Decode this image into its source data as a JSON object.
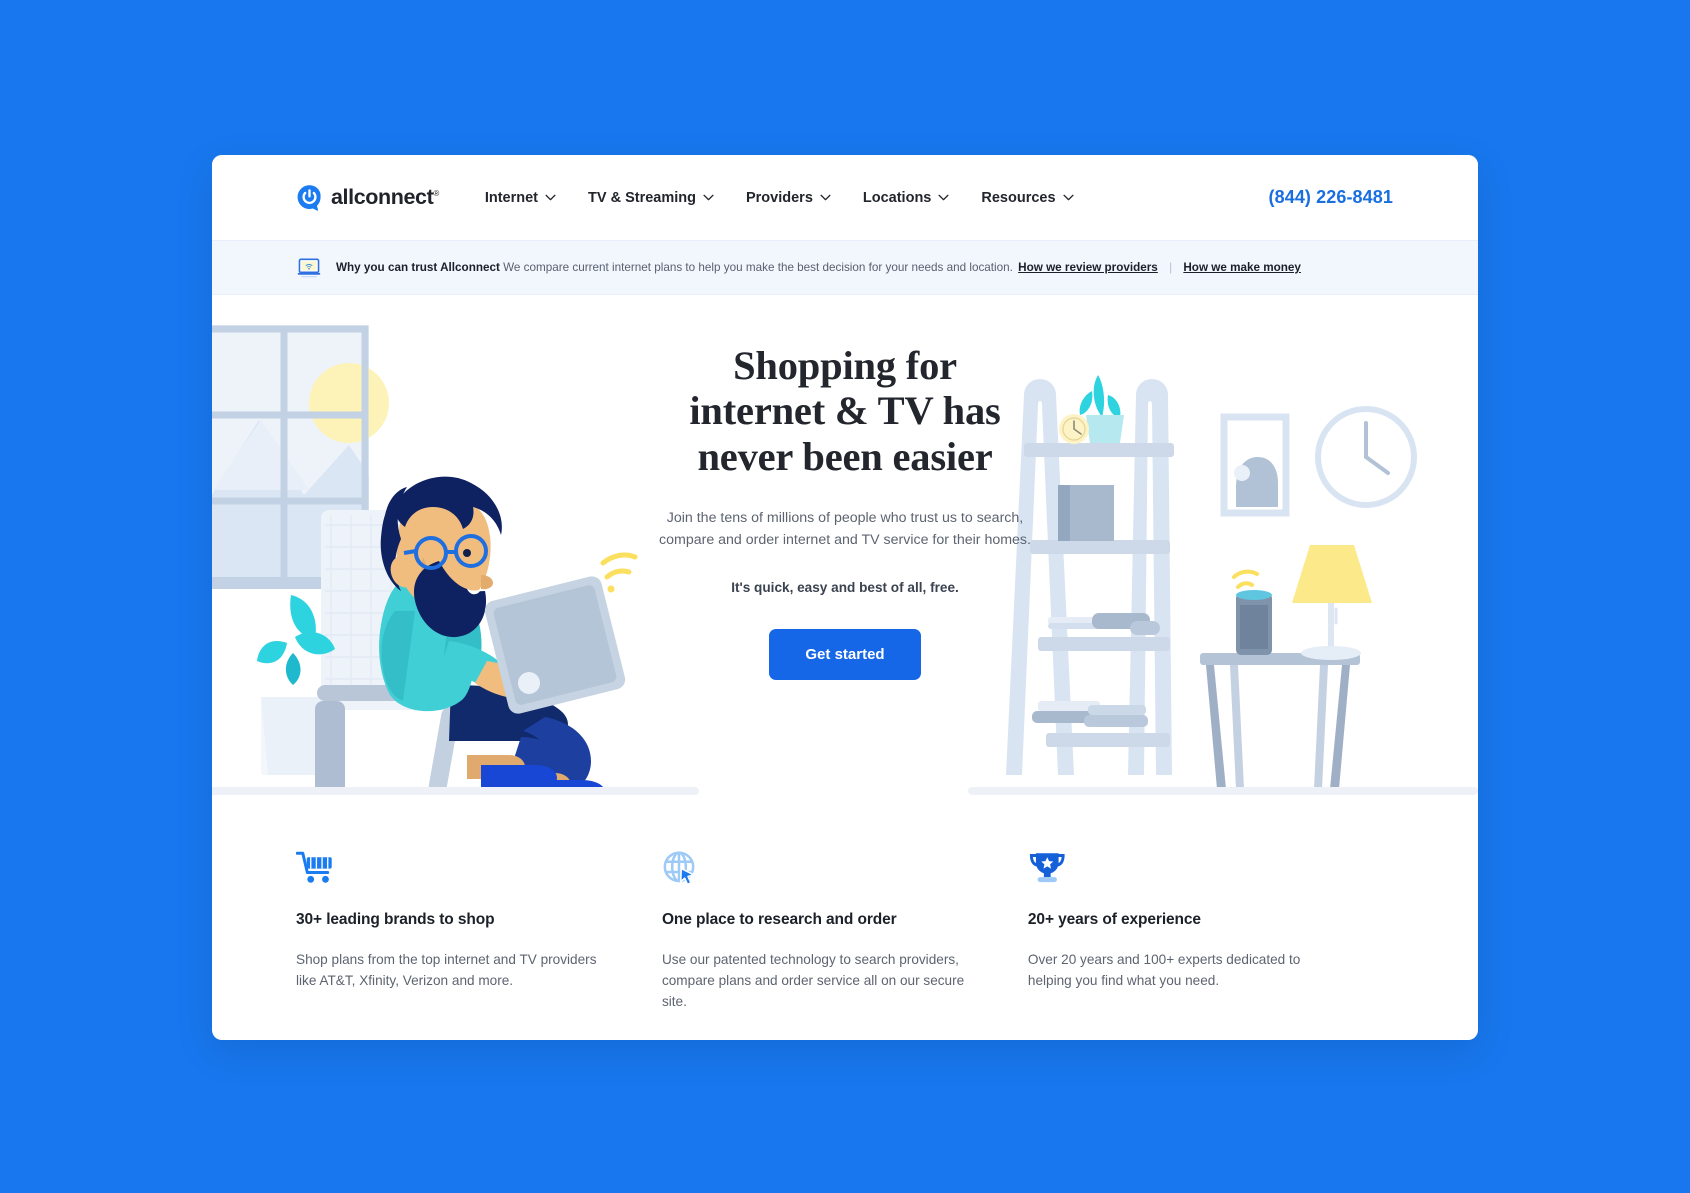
{
  "header": {
    "logo": {
      "text": "allconnect",
      "mark": "power-speech-bubble",
      "trademark": "®"
    },
    "nav": [
      {
        "label": "Internet",
        "icon": "chevron-down-icon"
      },
      {
        "label": "TV & Streaming",
        "icon": "chevron-down-icon"
      },
      {
        "label": "Providers",
        "icon": "chevron-down-icon"
      },
      {
        "label": "Locations",
        "icon": "chevron-down-icon"
      },
      {
        "label": "Resources",
        "icon": "chevron-down-icon"
      }
    ],
    "phone": "(844) 226-8481"
  },
  "trust_bar": {
    "icon": "laptop-wifi-icon",
    "headline": "Why you can trust Allconnect",
    "body": "We compare current internet plans to help you make the best decision for your needs and location.",
    "link_1": "How we review providers",
    "separator": "|",
    "link_2": "How we make money"
  },
  "hero": {
    "title_line_1": "Shopping for",
    "title_line_2": "internet & TV has",
    "title_line_3": "never been easier",
    "subtitle_line_1": "Join the tens of millions of people who trust us to search,",
    "subtitle_line_2": "compare and order internet and TV service for their homes.",
    "kicker": "It's quick, easy and best of all, free.",
    "cta_label": "Get started",
    "illustration_left": "man-in-chair-with-tablet",
    "illustration_right": "shelf-lamp-smart-speaker"
  },
  "features": [
    {
      "icon": "shopping-cart-icon",
      "title": "30+ leading brands to shop",
      "desc": "Shop plans from the top internet and TV providers like AT&T, Xfinity, Verizon and more."
    },
    {
      "icon": "globe-cursor-icon",
      "title": "One place to research and order",
      "desc": "Use our patented technology to search providers, compare plans and order service all on our secure site."
    },
    {
      "icon": "trophy-icon",
      "title": "20+ years of experience",
      "desc": "Over 20 years and 100+ experts dedicated to helping you find what you need."
    }
  ],
  "colors": {
    "page_background": "#1877ee",
    "brand_blue": "#1667e8",
    "link_blue": "#1a6fe0",
    "trust_bar_bg": "#f2f6fd",
    "heading": "#23262d",
    "body_text": "#5d6470"
  }
}
